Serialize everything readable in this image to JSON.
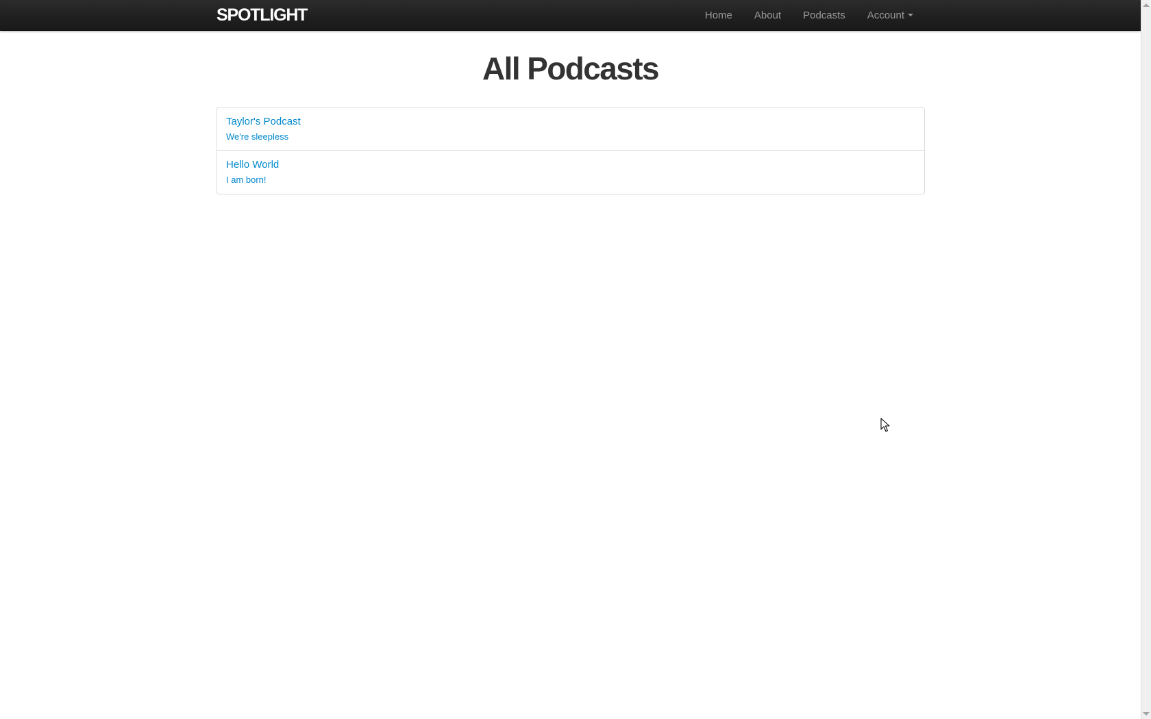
{
  "navbar": {
    "brand": "SPOTLIGHT",
    "items": [
      {
        "label": "Home"
      },
      {
        "label": "About"
      },
      {
        "label": "Podcasts"
      },
      {
        "label": "Account"
      }
    ]
  },
  "main": {
    "title": "All Podcasts",
    "podcasts": [
      {
        "title": "Taylor's Podcast",
        "description": "We're sleepless"
      },
      {
        "title": "Hello World",
        "description": "I am born!"
      }
    ]
  },
  "colors": {
    "navbar_bg": "#1f1f1f",
    "brand_text": "#ffffff",
    "nav_text": "#999999",
    "link": "#0088cc",
    "title_text": "#333333",
    "border": "#dddddd"
  },
  "icons": {
    "account_dropdown": "caret-down-icon",
    "pointer": "mouse-pointer-icon"
  }
}
